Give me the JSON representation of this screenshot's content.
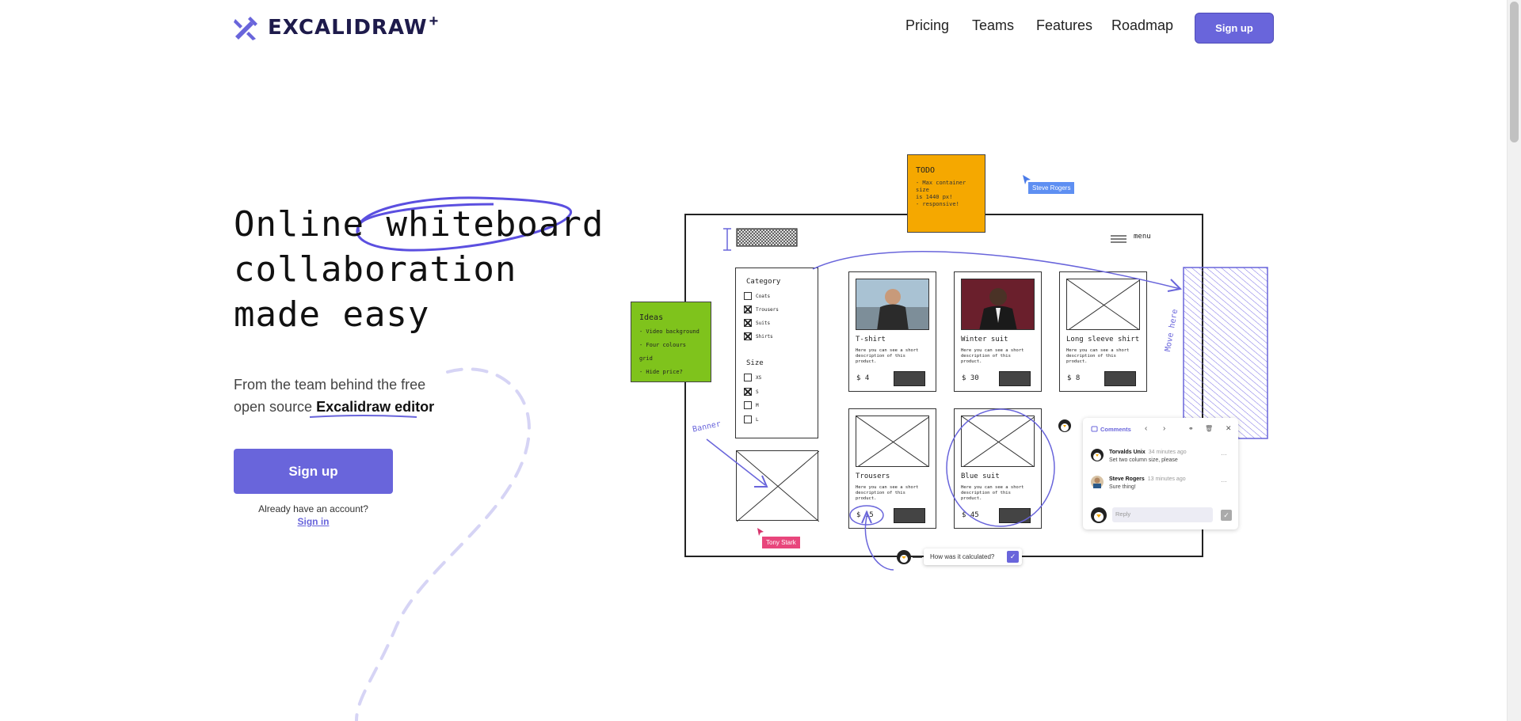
{
  "brand": {
    "name": "EXCALIDRAW",
    "plus": "+",
    "accent": "#6965db"
  },
  "nav": {
    "items": [
      "Pricing",
      "Teams",
      "Features",
      "Roadmap"
    ],
    "signup": "Sign up"
  },
  "hero": {
    "line1a": "Online",
    "line1b": "whiteboard",
    "line2": "collaboration",
    "line3": "made easy",
    "sub1": "From the team behind the free",
    "sub2a": "open source",
    "sub2b": "Excalidraw editor",
    "cta": "Sign up",
    "have_account": "Already have an account?",
    "signin": "Sign in"
  },
  "illustration": {
    "todo": {
      "title": "TODO",
      "lines": [
        "- Max container size",
        "is 1440 px!",
        "- responsive!"
      ]
    },
    "ideas": {
      "title": "Ideas",
      "lines": [
        "- Video background",
        "- Four colours grid",
        "- Hide price?"
      ]
    },
    "cursor_steve": "Steve Rogers",
    "cursor_tony": "Tony Stark",
    "menu": "menu",
    "filters": {
      "category": "Category",
      "cats": [
        "Coats",
        "Trousers",
        "Suits",
        "Shirts"
      ],
      "size": "Size",
      "sizes": [
        "XS",
        "S",
        "M",
        "L"
      ]
    },
    "cards": [
      {
        "title": "T-shirt",
        "price": "$ 4"
      },
      {
        "title": "Winter suit",
        "price": "$ 30"
      },
      {
        "title": "Long sleeve shirt",
        "price": "$ 8"
      },
      {
        "title": "Trousers",
        "price": "$ 15"
      },
      {
        "title": "Blue suit",
        "price": "$ 45"
      }
    ],
    "card_desc": "Here you can see a short description of this product.",
    "move_here": "Move here",
    "banner": "Banner",
    "comments": {
      "header": "Comments",
      "items": [
        {
          "author": "Torvalds Unix",
          "time": "34 minutes ago",
          "text": "Set two column size, please"
        },
        {
          "author": "Steve Rogers",
          "time": "13 minutes ago",
          "text": "Sure thing!"
        }
      ],
      "reply_placeholder": "Reply"
    },
    "calc_text": "How was it calculated?"
  }
}
